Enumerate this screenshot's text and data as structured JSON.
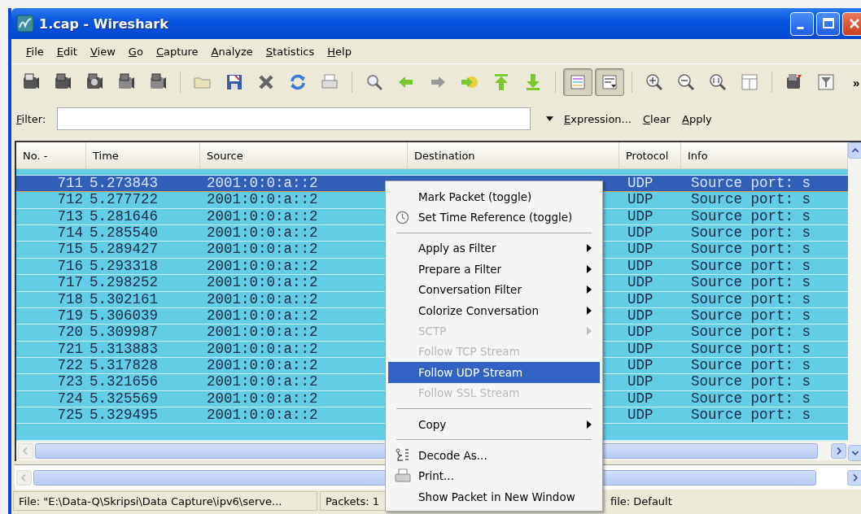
{
  "window": {
    "title": "1.cap - Wireshark"
  },
  "menu_bar": [
    {
      "label": "File",
      "first_letter_underlined": true
    },
    {
      "label": "Edit",
      "first_letter_underlined": true
    },
    {
      "label": "View",
      "first_letter_underlined": true
    },
    {
      "label": "Go",
      "first_letter_underlined": true
    },
    {
      "label": "Capture",
      "first_letter_underlined": true
    },
    {
      "label": "Analyze",
      "first_letter_underlined": true
    },
    {
      "label": "Statistics",
      "first_letter_underlined": true
    },
    {
      "label": "Help",
      "first_letter_underlined": true
    }
  ],
  "toolbar": {
    "buttons": [
      {
        "kind": "interfaces",
        "pressed": false
      },
      {
        "kind": "options",
        "pressed": false
      },
      {
        "kind": "start",
        "pressed": false
      },
      {
        "kind": "stop",
        "pressed": false
      },
      {
        "kind": "restart",
        "pressed": false
      },
      {
        "kind": "separator"
      },
      {
        "kind": "open",
        "pressed": false
      },
      {
        "kind": "save",
        "pressed": false
      },
      {
        "kind": "close",
        "pressed": false
      },
      {
        "kind": "reload",
        "pressed": false
      },
      {
        "kind": "print",
        "pressed": false
      },
      {
        "kind": "separator"
      },
      {
        "kind": "find",
        "pressed": false
      },
      {
        "kind": "back",
        "pressed": false
      },
      {
        "kind": "forward",
        "pressed": false
      },
      {
        "kind": "goto",
        "pressed": false
      },
      {
        "kind": "first",
        "pressed": false
      },
      {
        "kind": "last",
        "pressed": false
      },
      {
        "kind": "separator"
      },
      {
        "kind": "colorize",
        "pressed": true
      },
      {
        "kind": "autoscroll",
        "pressed": true
      },
      {
        "kind": "separator"
      },
      {
        "kind": "zoomin",
        "pressed": false
      },
      {
        "kind": "zoomout",
        "pressed": false
      },
      {
        "kind": "zoomreset",
        "pressed": false
      },
      {
        "kind": "resize",
        "pressed": false
      },
      {
        "kind": "separator"
      },
      {
        "kind": "capfilter",
        "pressed": false
      },
      {
        "kind": "dispfilter",
        "pressed": false
      }
    ],
    "overflow": "»"
  },
  "filter_bar": {
    "label": "Filter:",
    "first_letter_underlined": true,
    "links": [
      {
        "label": "Expression...",
        "first_letter_underlined": true
      },
      {
        "label": "Clear",
        "first_letter_underlined": true
      },
      {
        "label": "Apply",
        "first_letter_underlined": true
      }
    ]
  },
  "packet_list": {
    "columns": [
      "No. -",
      "Time",
      "Source",
      "Destination",
      "Protocol",
      "Info"
    ],
    "rows": [
      {
        "no": "711",
        "time": "5.273843",
        "source": "2001:0:0:a::2",
        "protocol": "UDP",
        "info": "Source port: s",
        "selected": true
      },
      {
        "no": "712",
        "time": "5.277722",
        "source": "2001:0:0:a::2",
        "protocol": "UDP",
        "info": "Source port: s",
        "selected": false
      },
      {
        "no": "713",
        "time": "5.281646",
        "source": "2001:0:0:a::2",
        "protocol": "UDP",
        "info": "Source port: s",
        "selected": false
      },
      {
        "no": "714",
        "time": "5.285540",
        "source": "2001:0:0:a::2",
        "protocol": "UDP",
        "info": "Source port: s",
        "selected": false
      },
      {
        "no": "715",
        "time": "5.289427",
        "source": "2001:0:0:a::2",
        "protocol": "UDP",
        "info": "Source port: s",
        "selected": false
      },
      {
        "no": "716",
        "time": "5.293318",
        "source": "2001:0:0:a::2",
        "protocol": "UDP",
        "info": "Source port: s",
        "selected": false
      },
      {
        "no": "717",
        "time": "5.298252",
        "source": "2001:0:0:a::2",
        "protocol": "UDP",
        "info": "Source port: s",
        "selected": false
      },
      {
        "no": "718",
        "time": "5.302161",
        "source": "2001:0:0:a::2",
        "protocol": "UDP",
        "info": "Source port: s",
        "selected": false
      },
      {
        "no": "719",
        "time": "5.306039",
        "source": "2001:0:0:a::2",
        "protocol": "UDP",
        "info": "Source port: s",
        "selected": false
      },
      {
        "no": "720",
        "time": "5.309987",
        "source": "2001:0:0:a::2",
        "protocol": "UDP",
        "info": "Source port: s",
        "selected": false
      },
      {
        "no": "721",
        "time": "5.313883",
        "source": "2001:0:0:a::2",
        "protocol": "UDP",
        "info": "Source port: s",
        "selected": false
      },
      {
        "no": "722",
        "time": "5.317828",
        "source": "2001:0:0:a::2",
        "protocol": "UDP",
        "info": "Source port: s",
        "selected": false
      },
      {
        "no": "723",
        "time": "5.321656",
        "source": "2001:0:0:a::2",
        "protocol": "UDP",
        "info": "Source port: s",
        "selected": false
      },
      {
        "no": "724",
        "time": "5.325569",
        "source": "2001:0:0:a::2",
        "protocol": "UDP",
        "info": "Source port: s",
        "selected": false
      },
      {
        "no": "725",
        "time": "5.329495",
        "source": "2001:0:0:a::2",
        "protocol": "UDP",
        "info": "Source port: s",
        "selected": false
      }
    ]
  },
  "context_menu": {
    "items": [
      {
        "kind": "plain",
        "label": "Mark Packet (toggle)",
        "disabled": false,
        "selected": false,
        "submenu": false
      },
      {
        "kind": "clock",
        "label": "Set Time Reference (toggle)",
        "disabled": false,
        "selected": false,
        "submenu": false
      },
      {
        "kind": "separator"
      },
      {
        "kind": "plain",
        "label": "Apply as Filter",
        "disabled": false,
        "selected": false,
        "submenu": true
      },
      {
        "kind": "plain",
        "label": "Prepare a Filter",
        "disabled": false,
        "selected": false,
        "submenu": true
      },
      {
        "kind": "plain",
        "label": "Conversation Filter",
        "disabled": false,
        "selected": false,
        "submenu": true
      },
      {
        "kind": "plain",
        "label": "Colorize Conversation",
        "disabled": false,
        "selected": false,
        "submenu": true
      },
      {
        "kind": "plain",
        "label": "SCTP",
        "disabled": true,
        "selected": false,
        "submenu": true
      },
      {
        "kind": "plain",
        "label": "Follow TCP Stream",
        "disabled": true,
        "selected": false,
        "submenu": false
      },
      {
        "kind": "plain",
        "label": "Follow UDP Stream",
        "disabled": false,
        "selected": true,
        "submenu": false
      },
      {
        "kind": "plain",
        "label": "Follow SSL Stream",
        "disabled": true,
        "selected": false,
        "submenu": false
      },
      {
        "kind": "separator"
      },
      {
        "kind": "plain",
        "label": "Copy",
        "disabled": false,
        "selected": false,
        "submenu": true
      },
      {
        "kind": "separator"
      },
      {
        "kind": "decode",
        "label": "Decode As...",
        "disabled": false,
        "selected": false,
        "submenu": false
      },
      {
        "kind": "print",
        "label": "Print...",
        "disabled": false,
        "selected": false,
        "submenu": false
      },
      {
        "kind": "plain",
        "label": "Show Packet in New Window",
        "disabled": false,
        "selected": false,
        "submenu": false
      }
    ]
  },
  "status_bar": [
    "File: \"E:\\Data-Q\\Skripsi\\Data Capture\\ipv6\\serve...",
    "Packets: 1",
    "file: Default"
  ]
}
